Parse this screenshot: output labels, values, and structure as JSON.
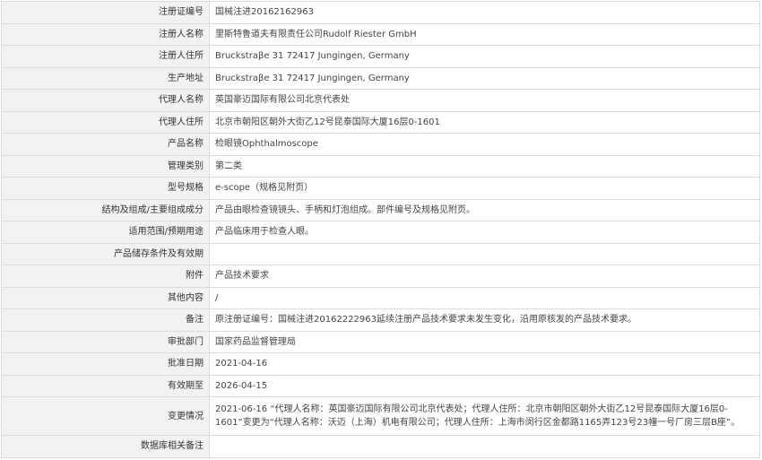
{
  "rows": [
    {
      "label": "注册证编号",
      "value": "国械注进20162162963"
    },
    {
      "label": "注册人名称",
      "value": "里斯特鲁道夫有限责任公司Rudolf Riester GmbH"
    },
    {
      "label": "注册人住所",
      "value": "Bruckstraβe 31 72417 Jungingen, Germany"
    },
    {
      "label": "生产地址",
      "value": "Bruckstraβe 31 72417 Jungingen, Germany"
    },
    {
      "label": "代理人名称",
      "value": "英国豪迈国际有限公司北京代表处"
    },
    {
      "label": "代理人住所",
      "value": "北京市朝阳区朝外大街乙12号昆泰国际大厦16层0-1601"
    },
    {
      "label": "产品名称",
      "value": "检眼镜Ophthalmoscope"
    },
    {
      "label": "管理类别",
      "value": "第二类"
    },
    {
      "label": "型号规格",
      "value": "e-scope（规格见附页）"
    },
    {
      "label": "结构及组成/主要组成成分",
      "value": "产品由眼检查镜镜头、手柄和灯泡组成。部件编号及规格见附页。"
    },
    {
      "label": "适用范围/预期用途",
      "value": "产品临床用于检查人眼。"
    },
    {
      "label": "产品储存条件及有效期",
      "value": ""
    },
    {
      "label": "附件",
      "value": "产品技术要求"
    },
    {
      "label": "其他内容",
      "value": "/"
    },
    {
      "label": "备注",
      "value": "原注册证编号：国械注进20162222963延续注册产品技术要求未发生变化，沿用原核发的产品技术要求。"
    },
    {
      "label": "审批部门",
      "value": "国家药品监督管理局"
    },
    {
      "label": "批准日期",
      "value": "2021-04-16"
    },
    {
      "label": "有效期至",
      "value": "2026-04-15"
    },
    {
      "label": "变更情况",
      "value": "2021-06-16 “代理人名称：英国豪迈国际有限公司北京代表处；代理人住所：北京市朝阳区朝外大街乙12号昆泰国际大厦16层0-1601”变更为“代理人名称：沃迈（上海）机电有限公司；代理人住所：上海市闵行区金都路1165弄123号23幢一号厂房三层B座”。"
    },
    {
      "label": "数据库相关备注",
      "value": ""
    }
  ]
}
